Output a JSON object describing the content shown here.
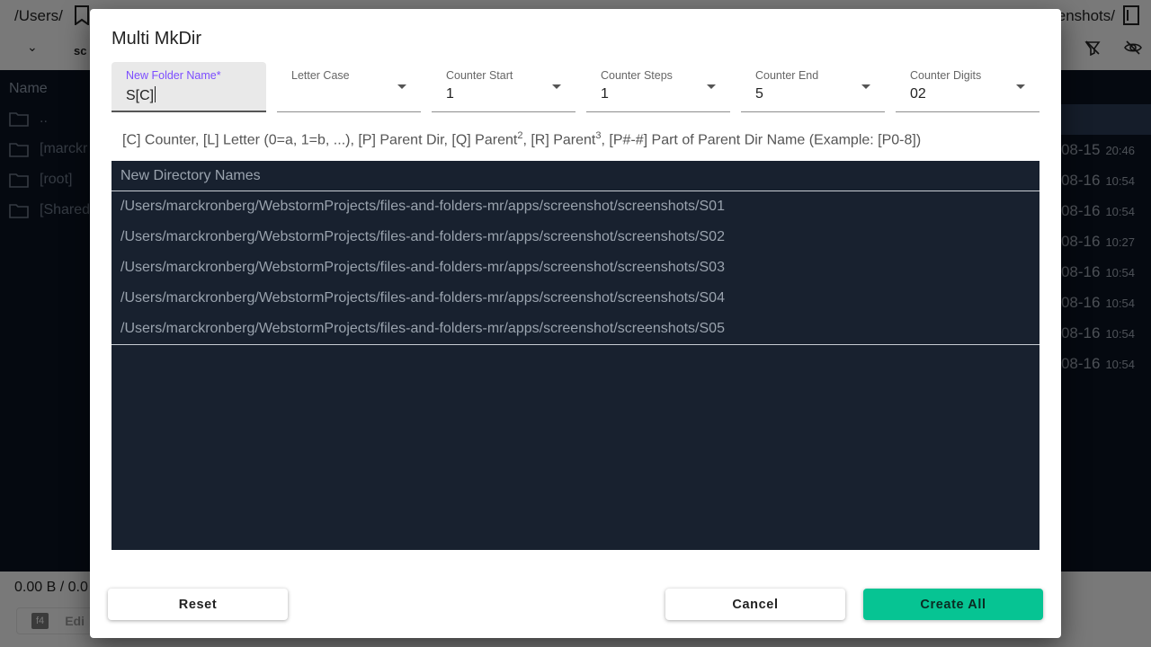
{
  "background": {
    "path_left": "/Users/",
    "path_right": "enshots/",
    "tab_label": "sc",
    "list_header": "Name",
    "rows": [
      {
        "name": ".."
      },
      {
        "name": "[marckr"
      },
      {
        "name": "[root]"
      },
      {
        "name": "[Shared"
      }
    ],
    "dates": [
      {
        "date": "08-15",
        "time": "20:46"
      },
      {
        "date": "08-16",
        "time": "10:54"
      },
      {
        "date": "08-16",
        "time": "10:54"
      },
      {
        "date": "08-16",
        "time": "10:27"
      },
      {
        "date": "08-16",
        "time": "10:54"
      },
      {
        "date": "08-16",
        "time": "10:54"
      },
      {
        "date": "08-16",
        "time": "10:54"
      },
      {
        "date": "08-16",
        "time": "10:54"
      }
    ],
    "status_text": "0.00 B / 0.0",
    "f4_key": "f4",
    "f4_label": "Edi"
  },
  "dialog": {
    "title": "Multi MkDir",
    "fields": {
      "folder_name": {
        "label": "New Folder Name*",
        "value": "S[C]"
      },
      "letter_case": {
        "label": "Letter Case",
        "value": ""
      },
      "counter_start": {
        "label": "Counter Start",
        "value": "1"
      },
      "counter_steps": {
        "label": "Counter Steps",
        "value": "1"
      },
      "counter_end": {
        "label": "Counter End",
        "value": "5"
      },
      "counter_digits": {
        "label": "Counter Digits",
        "value": "02"
      }
    },
    "hint": {
      "part1": "[C] Counter, [L] Letter (0=a, 1=b, ...), [P] Parent Dir, [Q] Parent",
      "sup1": "2",
      "part2": ", [R] Parent",
      "sup2": "3",
      "part3": ", [P#-#] Part of Parent Dir Name (Example: [P0-8])"
    },
    "table": {
      "header": "New Directory Names",
      "rows": [
        "/Users/marckronberg/WebstormProjects/files-and-folders-mr/apps/screenshot/screenshots/S01",
        "/Users/marckronberg/WebstormProjects/files-and-folders-mr/apps/screenshot/screenshots/S02",
        "/Users/marckronberg/WebstormProjects/files-and-folders-mr/apps/screenshot/screenshots/S03",
        "/Users/marckronberg/WebstormProjects/files-and-folders-mr/apps/screenshot/screenshots/S04",
        "/Users/marckronberg/WebstormProjects/files-and-folders-mr/apps/screenshot/screenshots/S05"
      ]
    },
    "buttons": {
      "reset": "Reset",
      "cancel": "Cancel",
      "create_all": "Create All"
    }
  }
}
